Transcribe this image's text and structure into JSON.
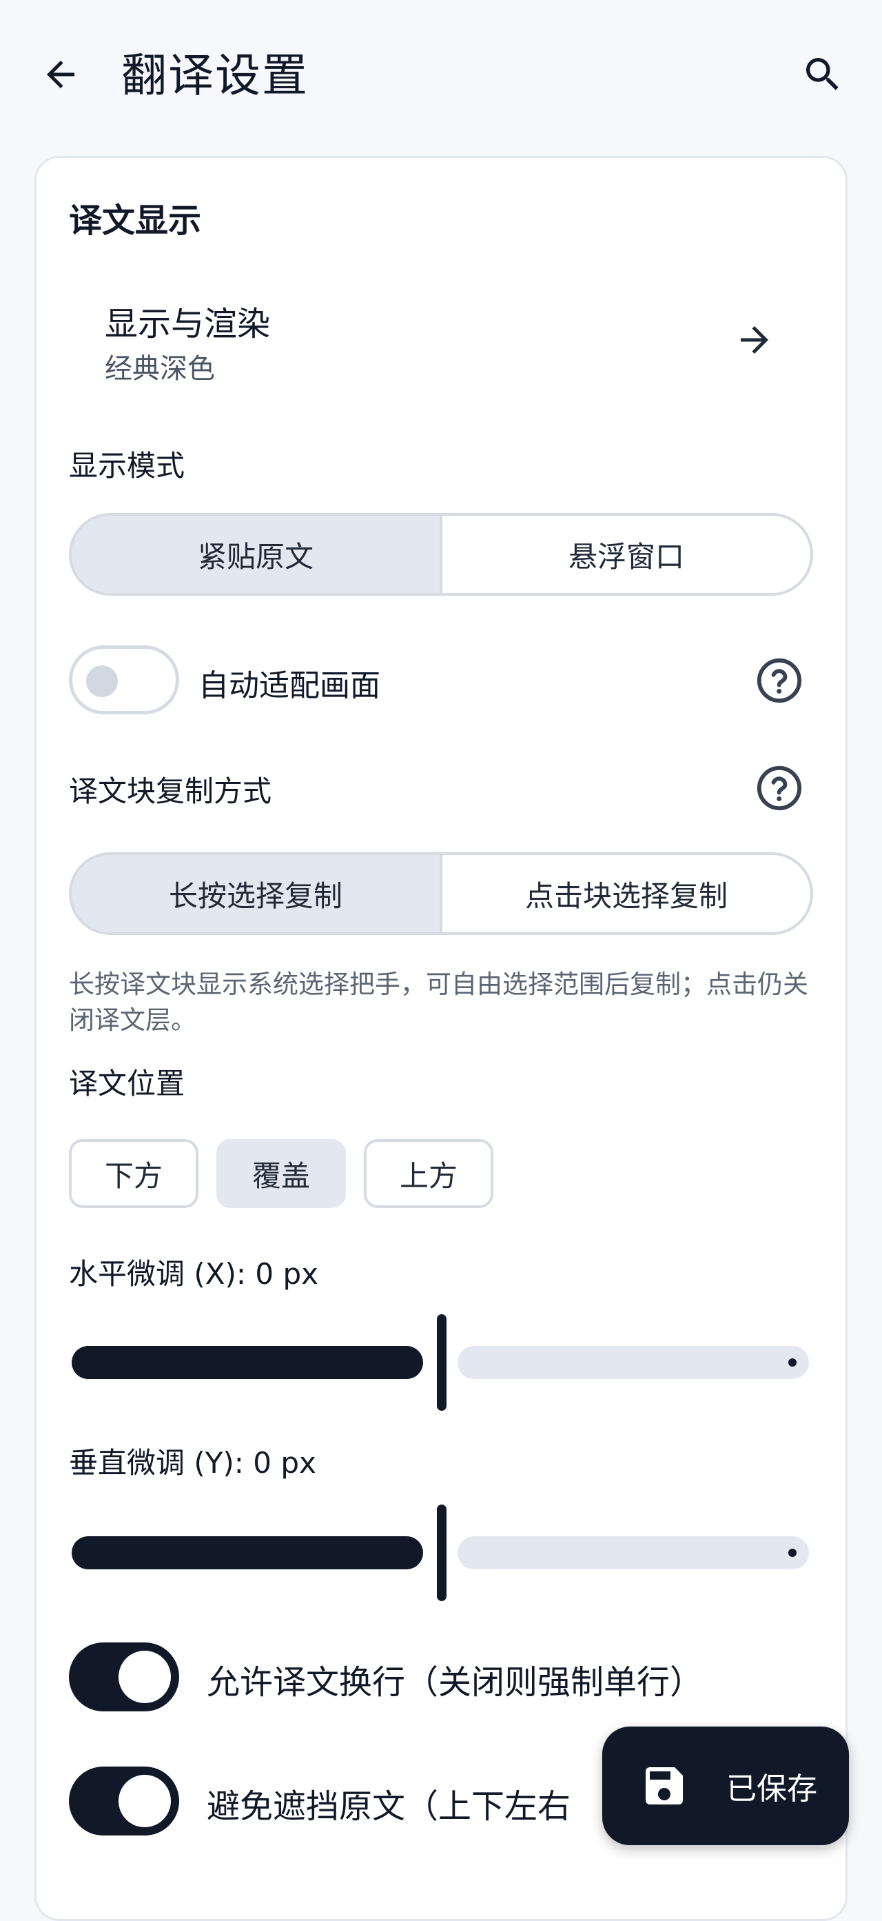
{
  "header": {
    "title": "翻译设置",
    "back_icon": "arrow-left-icon",
    "search_icon": "search-icon"
  },
  "display": {
    "section_title": "译文显示",
    "render": {
      "title": "显示与渲染",
      "subtitle": "经典深色",
      "icon": "arrow-right-icon"
    },
    "mode": {
      "label": "显示模式",
      "options": [
        "紧贴原文",
        "悬浮窗口"
      ],
      "selected": "紧贴原文"
    },
    "auto_fit": {
      "label": "自动适配画面",
      "enabled": false
    },
    "copy_mode": {
      "label": "译文块复制方式",
      "options": [
        "长按选择复制",
        "点击块选择复制"
      ],
      "selected": "长按选择复制",
      "description": "长按译文块显示系统选择把手，可自由选择范围后复制；点击仍关闭译文层。"
    },
    "position": {
      "label": "译文位置",
      "options": [
        "下方",
        "覆盖",
        "上方"
      ],
      "selected": "覆盖"
    },
    "offset_x": {
      "label": "水平微调 (X): 0 px",
      "value": 0
    },
    "offset_y": {
      "label": "垂直微调 (Y): 0 px",
      "value": 0
    },
    "wrap": {
      "label": "允许译文换行（关闭则强制单行）",
      "enabled": true
    },
    "avoid": {
      "label": "避免遮挡原文（上下左右",
      "enabled": true
    }
  },
  "fab": {
    "label": "已保存",
    "icon": "save-icon"
  },
  "colors": {
    "background": "#f6f8fc",
    "card": "#ffffff",
    "accent": "#111827",
    "selected_fill": "#e3e8f0",
    "border": "#d6dbe3",
    "muted_text": "#5b6574"
  }
}
